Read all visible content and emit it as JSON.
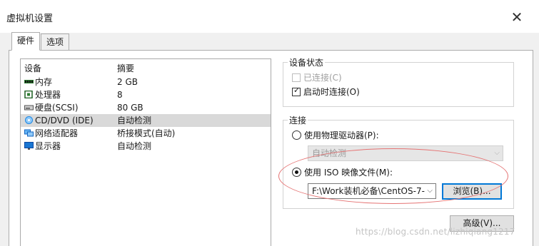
{
  "window": {
    "title": "虚拟机设置",
    "close_glyph": "✕"
  },
  "tabs": [
    {
      "label": "硬件",
      "active": true
    },
    {
      "label": "选项",
      "active": false
    }
  ],
  "device_list": {
    "columns": {
      "device": "设备",
      "summary": "摘要"
    },
    "rows": [
      {
        "icon": "memory-icon",
        "name": "内存",
        "summary": "2 GB"
      },
      {
        "icon": "processor-icon",
        "name": "处理器",
        "summary": "8"
      },
      {
        "icon": "hard-disk-icon",
        "name": "硬盘(SCSI)",
        "summary": "80 GB"
      },
      {
        "icon": "cd-dvd-icon",
        "name": "CD/DVD (IDE)",
        "summary": "自动检测",
        "selected": true
      },
      {
        "icon": "network-adapter-icon",
        "name": "网络适配器",
        "summary": "桥接模式(自动)"
      },
      {
        "icon": "display-icon",
        "name": "显示器",
        "summary": "自动检测"
      }
    ]
  },
  "device_status": {
    "title": "设备状态",
    "connected": {
      "label": "已连接(C)",
      "checked": false,
      "enabled": false
    },
    "connect_at_power_on": {
      "label": "启动时连接(O)",
      "checked": true,
      "enabled": true
    }
  },
  "connection": {
    "title": "连接",
    "physical_drive": {
      "label": "使用物理驱动器(P):",
      "selected": false
    },
    "physical_drive_value": "自动检测",
    "iso_image": {
      "label": "使用 ISO 映像文件(M):",
      "selected": true
    },
    "iso_path": "F:\\Work装机必备\\CentOS-7-",
    "browse_label": "浏览(B)..."
  },
  "advanced_label": "高级(V)...",
  "watermark": "https://blog.csdn.net/lizhiqiang1217",
  "colors": {
    "selected_row": "#d9d9d9",
    "highlight_ellipse": "#e57373",
    "focus_border": "#0078d7"
  }
}
